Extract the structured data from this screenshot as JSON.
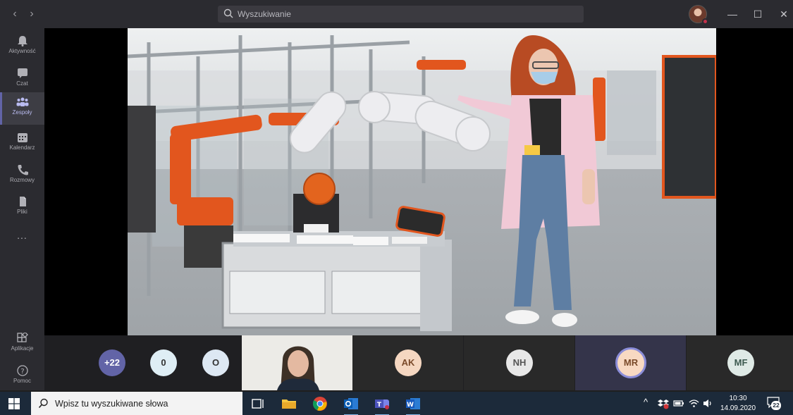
{
  "titlebar": {
    "search_placeholder": "Wyszukiwanie"
  },
  "rail": {
    "items": [
      {
        "label": "Aktywność"
      },
      {
        "label": "Czat"
      },
      {
        "label": "Zespoły"
      },
      {
        "label": "Kalendarz"
      },
      {
        "label": "Rozmowy"
      },
      {
        "label": "Pliki"
      },
      {
        "label": "..."
      },
      {
        "label": "Aplikacje"
      },
      {
        "label": "Pomoc"
      }
    ]
  },
  "participants": {
    "overflow": "+22",
    "bubbles": [
      "0",
      "O"
    ],
    "tiles": [
      "AK",
      "NH",
      "MR",
      "MF"
    ]
  },
  "taskbar": {
    "search_placeholder": "Wpisz tu wyszukiwane słowa",
    "time": "10:30",
    "date": "14.09.2020",
    "notifications": "22"
  },
  "colors": {
    "teams_purple": "#6264a7",
    "chrome_dark": "#2b2b30",
    "taskbar": "#1c2a3a"
  }
}
